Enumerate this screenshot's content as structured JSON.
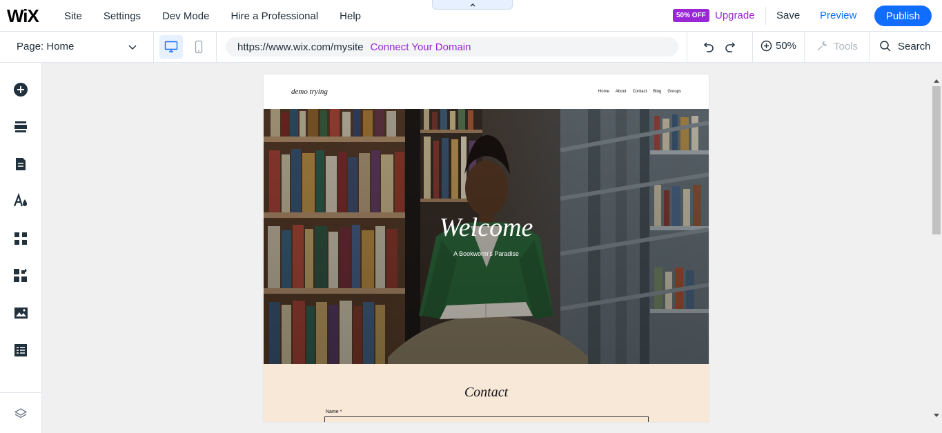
{
  "app": {
    "logo": "WiX"
  },
  "menu": {
    "site": "Site",
    "settings": "Settings",
    "dev_mode": "Dev Mode",
    "hire": "Hire a Professional",
    "help": "Help"
  },
  "topbar": {
    "badge": "50% OFF",
    "upgrade": "Upgrade",
    "save": "Save",
    "preview": "Preview",
    "publish": "Publish"
  },
  "subbar": {
    "page_label": "Page: Home",
    "url": "https://www.wix.com/mysite",
    "connect_domain": "Connect Your Domain",
    "zoom": "50%",
    "tools": "Tools",
    "search": "Search"
  },
  "site": {
    "name": "demo trying",
    "nav": [
      "Home",
      "About",
      "Contact",
      "Blog",
      "Groups"
    ],
    "hero_title": "Welcome",
    "hero_subtitle": "A Bookworm's Paradise",
    "contact_title": "Contact",
    "name_label": "Name *"
  },
  "colors": {
    "accent": "#116dff",
    "upgrade": "#9a27d5",
    "contact_bg": "#f8e8d8"
  },
  "icons": {
    "rail": [
      "add-icon",
      "sections-icon",
      "pages-icon",
      "design-icon",
      "apps-icon",
      "business-apps-icon",
      "media-icon",
      "cms-icon",
      "layers-icon"
    ]
  }
}
